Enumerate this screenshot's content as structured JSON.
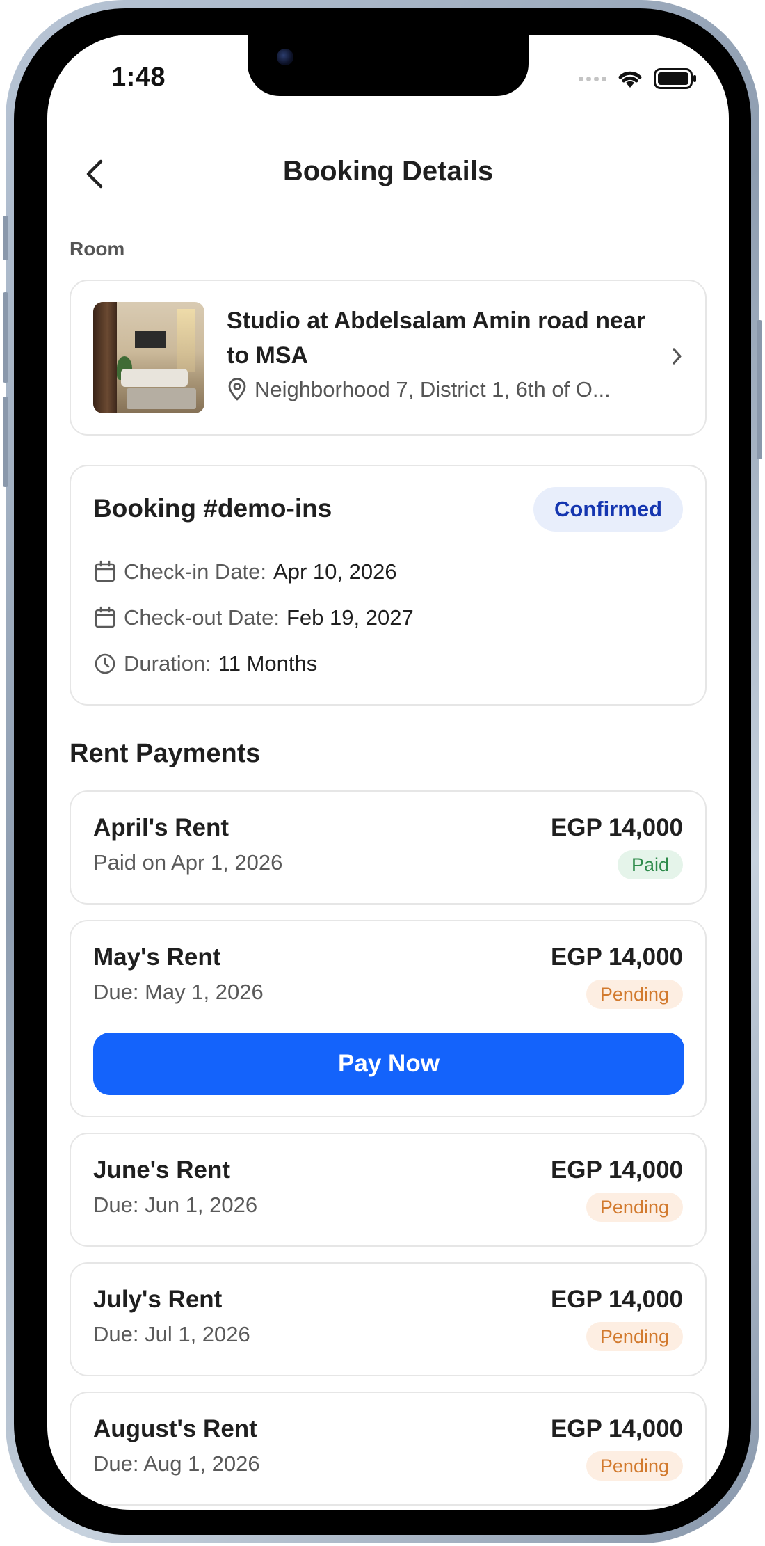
{
  "status_bar": {
    "time": "1:48"
  },
  "header": {
    "title": "Booking Details"
  },
  "room_section": {
    "label": "Room",
    "title": "Studio at Abdelsalam Amin road near to MSA",
    "location": "Neighborhood 7, District 1, 6th of O..."
  },
  "booking": {
    "title": "Booking #demo-ins",
    "status": "Confirmed",
    "checkin_label": "Check-in Date:",
    "checkin_value": "Apr 10, 2026",
    "checkout_label": "Check-out Date:",
    "checkout_value": "Feb 19, 2027",
    "duration_label": "Duration:",
    "duration_value": "11 Months"
  },
  "rent_payments": {
    "heading": "Rent Payments",
    "pay_button_label": "Pay Now",
    "items": [
      {
        "name": "April's Rent",
        "sub": "Paid on Apr 1, 2026",
        "amount": "EGP 14,000",
        "status": "Paid"
      },
      {
        "name": "May's Rent",
        "sub": "Due: May 1, 2026",
        "amount": "EGP 14,000",
        "status": "Pending"
      },
      {
        "name": "June's Rent",
        "sub": "Due: Jun 1, 2026",
        "amount": "EGP 14,000",
        "status": "Pending"
      },
      {
        "name": "July's Rent",
        "sub": "Due: Jul 1, 2026",
        "amount": "EGP 14,000",
        "status": "Pending"
      },
      {
        "name": "August's Rent",
        "sub": "Due: Aug 1, 2026",
        "amount": "EGP 14,000",
        "status": "Pending"
      }
    ]
  },
  "colors": {
    "primary": "#1463fb",
    "confirmed_bg": "#e8eefb",
    "confirmed_text": "#1536b0",
    "paid_bg": "#e5f4ea",
    "paid_text": "#2e8b4b",
    "pending_bg": "#fdeee2",
    "pending_text": "#d27a2e"
  },
  "icons": [
    "back-arrow-icon",
    "wifi-icon",
    "battery-icon",
    "location-pin-icon",
    "chevron-right-icon",
    "calendar-icon",
    "clock-icon"
  ]
}
